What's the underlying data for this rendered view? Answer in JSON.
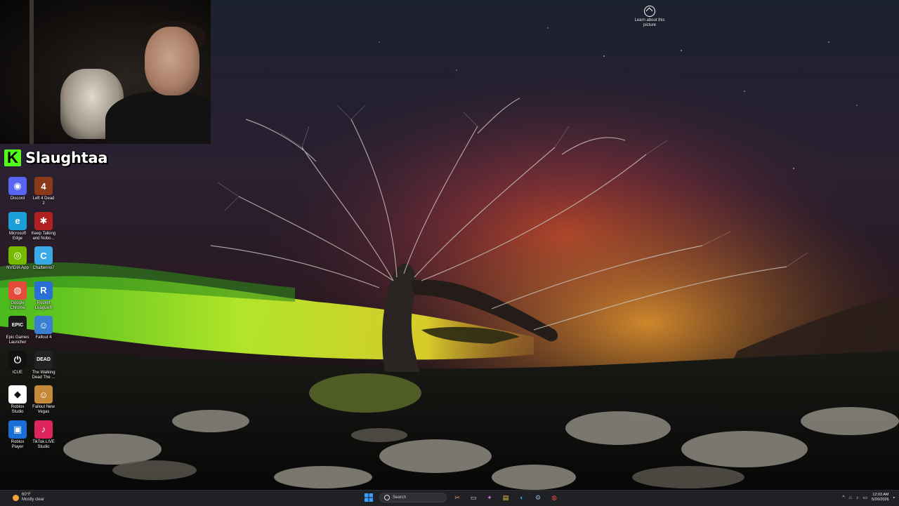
{
  "overlay": {
    "streamer_name": "Slaughtaa",
    "kick_logo_letter": "K"
  },
  "wallpaper": {
    "learn_label": "Learn about this picture"
  },
  "desktop_icons": [
    {
      "label": "Discord",
      "icon": "discord-icon",
      "color": "#5865f2",
      "glyph": "◉"
    },
    {
      "label": "Left 4 Dead 2",
      "icon": "left4dead2-icon",
      "color": "#8a3a1a",
      "glyph": "4"
    },
    {
      "label": "Microsoft Edge",
      "icon": "edge-icon",
      "color": "#1a9fd9",
      "glyph": "e"
    },
    {
      "label": "Keep Talking and Nobo...",
      "icon": "keep-talking-icon",
      "color": "#b02020",
      "glyph": "✱"
    },
    {
      "label": "NVIDIA App",
      "icon": "nvidia-icon",
      "color": "#76b900",
      "glyph": "◎"
    },
    {
      "label": "Chatterino7",
      "icon": "chatterino-icon",
      "color": "#3aa9e8",
      "glyph": "C"
    },
    {
      "label": "Google Chrome",
      "icon": "chrome-icon",
      "color": "#e64a3a",
      "glyph": "◍"
    },
    {
      "label": "Rocket League®",
      "icon": "rocket-league-icon",
      "color": "#2a6fd6",
      "glyph": "R"
    },
    {
      "label": "Epic Games Launcher",
      "icon": "epic-games-icon",
      "color": "#1a1a1a",
      "glyph": "EPIC"
    },
    {
      "label": "Fallout 4",
      "icon": "fallout4-icon",
      "color": "#3a7fd0",
      "glyph": "☺"
    },
    {
      "label": "iCUE",
      "icon": "icue-icon",
      "color": "#111111",
      "glyph": "⏻"
    },
    {
      "label": "The Walking Dead The ...",
      "icon": "walking-dead-icon",
      "color": "#222222",
      "glyph": "DEAD"
    },
    {
      "label": "Roblox Studio",
      "icon": "roblox-studio-icon",
      "color": "#ffffff",
      "glyph": "◆"
    },
    {
      "label": "Fallout New Vegas",
      "icon": "fallout-nv-icon",
      "color": "#c48a3a",
      "glyph": "☺"
    },
    {
      "label": "Roblox Player",
      "icon": "roblox-player-icon",
      "color": "#1a6fd6",
      "glyph": "▣"
    },
    {
      "label": "TikTok LIVE Studio",
      "icon": "tiktok-icon",
      "color": "#e0245e",
      "glyph": "♪"
    }
  ],
  "taskbar": {
    "weather_temp": "60°F",
    "weather_desc": "Mostly clear",
    "search_placeholder": "Search",
    "time": "12:03 AM",
    "date": "5/26/2026",
    "pinned_apps": [
      "start-icon",
      "search-box",
      "snip-tool-icon",
      "task-view-icon",
      "copilot-icon",
      "file-explorer-icon",
      "edge-icon",
      "steam-icon",
      "chrome-icon"
    ]
  }
}
